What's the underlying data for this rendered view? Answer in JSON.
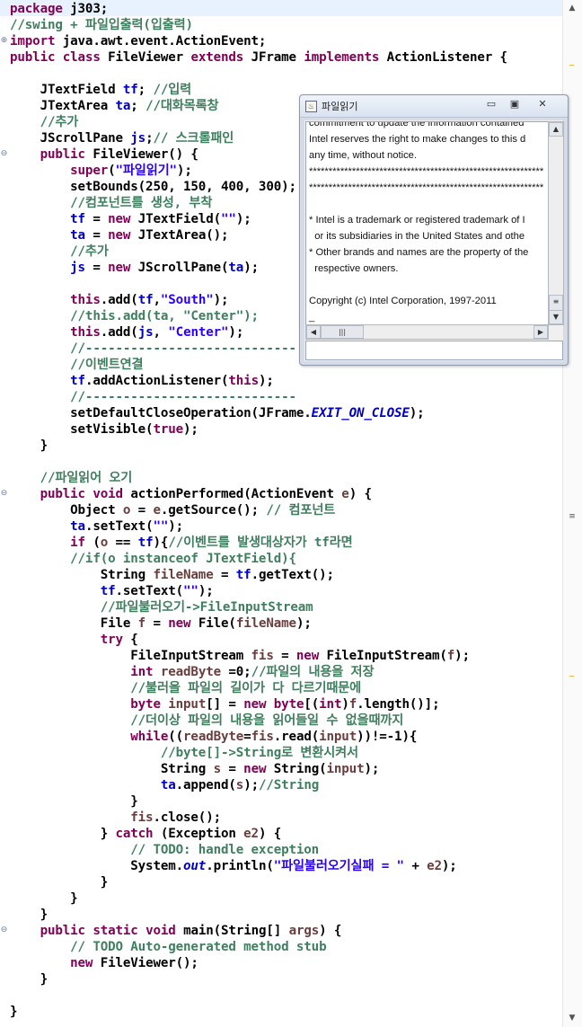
{
  "code_lines": [
    [
      [
        "kw",
        "package"
      ],
      [
        "plain",
        " j303;"
      ]
    ],
    [
      [
        "cm",
        "//swing + 파일입출력(입출력)"
      ]
    ],
    [
      [
        "kw",
        "import"
      ],
      [
        "plain",
        " java.awt.event.ActionEvent;"
      ]
    ],
    [
      [
        "kw",
        "public"
      ],
      [
        "plain",
        " "
      ],
      [
        "kw",
        "class"
      ],
      [
        "plain",
        " FileViewer "
      ],
      [
        "kw",
        "extends"
      ],
      [
        "plain",
        " JFrame "
      ],
      [
        "kw",
        "implements"
      ],
      [
        "plain",
        " ActionListener {"
      ]
    ],
    [],
    [
      [
        "plain",
        "    JTextField "
      ],
      [
        "fld",
        "tf"
      ],
      [
        "plain",
        "; "
      ],
      [
        "cm",
        "//입력"
      ]
    ],
    [
      [
        "plain",
        "    JTextArea "
      ],
      [
        "fld",
        "ta"
      ],
      [
        "plain",
        "; "
      ],
      [
        "cm",
        "//대화목록창"
      ]
    ],
    [
      [
        "plain",
        "    "
      ],
      [
        "cm",
        "//추가"
      ]
    ],
    [
      [
        "plain",
        "    JScrollPane "
      ],
      [
        "fld",
        "js"
      ],
      [
        "plain",
        ";"
      ],
      [
        "cm",
        "// 스크롤패인"
      ]
    ],
    [
      [
        "plain",
        "    "
      ],
      [
        "kw",
        "public"
      ],
      [
        "plain",
        " FileViewer() {"
      ]
    ],
    [
      [
        "plain",
        "        "
      ],
      [
        "kw",
        "super"
      ],
      [
        "plain",
        "("
      ],
      [
        "str",
        "\"파일읽기\""
      ],
      [
        "plain",
        ");"
      ]
    ],
    [
      [
        "plain",
        "        setBounds(250, 150, 400, 300);"
      ]
    ],
    [
      [
        "plain",
        "        "
      ],
      [
        "cm",
        "//컴포넌트를 생성, 부착"
      ]
    ],
    [
      [
        "plain",
        "        "
      ],
      [
        "fld",
        "tf"
      ],
      [
        "plain",
        " = "
      ],
      [
        "kw",
        "new"
      ],
      [
        "plain",
        " JTextField("
      ],
      [
        "str",
        "\"\""
      ],
      [
        "plain",
        ");"
      ]
    ],
    [
      [
        "plain",
        "        "
      ],
      [
        "fld",
        "ta"
      ],
      [
        "plain",
        " = "
      ],
      [
        "kw",
        "new"
      ],
      [
        "plain",
        " JTextArea();"
      ]
    ],
    [
      [
        "plain",
        "        "
      ],
      [
        "cm",
        "//추가"
      ]
    ],
    [
      [
        "plain",
        "        "
      ],
      [
        "fld",
        "js"
      ],
      [
        "plain",
        " = "
      ],
      [
        "kw",
        "new"
      ],
      [
        "plain",
        " JScrollPane("
      ],
      [
        "fld",
        "ta"
      ],
      [
        "plain",
        ");"
      ]
    ],
    [],
    [
      [
        "plain",
        "        "
      ],
      [
        "kw",
        "this"
      ],
      [
        "plain",
        ".add("
      ],
      [
        "fld",
        "tf"
      ],
      [
        "plain",
        ","
      ],
      [
        "str",
        "\"South\""
      ],
      [
        "plain",
        ");"
      ]
    ],
    [
      [
        "plain",
        "        "
      ],
      [
        "cm",
        "//this.add(ta, \"Center\");"
      ]
    ],
    [
      [
        "plain",
        "        "
      ],
      [
        "kw",
        "this"
      ],
      [
        "plain",
        ".add("
      ],
      [
        "fld",
        "js"
      ],
      [
        "plain",
        ", "
      ],
      [
        "str",
        "\"Center\""
      ],
      [
        "plain",
        ");"
      ]
    ],
    [
      [
        "plain",
        "        "
      ],
      [
        "cm",
        "//----------------------------"
      ]
    ],
    [
      [
        "plain",
        "        "
      ],
      [
        "cm",
        "//이벤트연결"
      ]
    ],
    [
      [
        "plain",
        "        "
      ],
      [
        "fld",
        "tf"
      ],
      [
        "plain",
        ".addActionListener("
      ],
      [
        "kw",
        "this"
      ],
      [
        "plain",
        ");"
      ]
    ],
    [
      [
        "plain",
        "        "
      ],
      [
        "cm",
        "//----------------------------"
      ]
    ],
    [
      [
        "plain",
        "        setDefaultCloseOperation(JFrame."
      ],
      [
        "sfld",
        "EXIT_ON_CLOSE"
      ],
      [
        "plain",
        ");"
      ]
    ],
    [
      [
        "plain",
        "        setVisible("
      ],
      [
        "kw",
        "true"
      ],
      [
        "plain",
        ");"
      ]
    ],
    [
      [
        "plain",
        "    }"
      ]
    ],
    [],
    [
      [
        "plain",
        "    "
      ],
      [
        "cm",
        "//파일읽어 오기"
      ]
    ],
    [
      [
        "plain",
        "    "
      ],
      [
        "kw",
        "public"
      ],
      [
        "plain",
        " "
      ],
      [
        "kw",
        "void"
      ],
      [
        "plain",
        " actionPerformed(ActionEvent "
      ],
      [
        "var",
        "e"
      ],
      [
        "plain",
        ") {"
      ]
    ],
    [
      [
        "plain",
        "        Object "
      ],
      [
        "var",
        "o"
      ],
      [
        "plain",
        " = "
      ],
      [
        "var",
        "e"
      ],
      [
        "plain",
        ".getSource(); "
      ],
      [
        "cm",
        "// 컴포넌트"
      ]
    ],
    [
      [
        "plain",
        "        "
      ],
      [
        "fld",
        "ta"
      ],
      [
        "plain",
        ".setText("
      ],
      [
        "str",
        "\"\""
      ],
      [
        "plain",
        ");"
      ]
    ],
    [
      [
        "plain",
        "        "
      ],
      [
        "kw",
        "if"
      ],
      [
        "plain",
        " ("
      ],
      [
        "var",
        "o"
      ],
      [
        "plain",
        " == "
      ],
      [
        "fld",
        "tf"
      ],
      [
        "plain",
        "){"
      ],
      [
        "cm",
        "//이벤트를 발생대상자가 tf라면"
      ]
    ],
    [
      [
        "plain",
        "        "
      ],
      [
        "cm",
        "//if(o instanceof JTextField){"
      ]
    ],
    [
      [
        "plain",
        "            String "
      ],
      [
        "var",
        "fileName"
      ],
      [
        "plain",
        " = "
      ],
      [
        "fld",
        "tf"
      ],
      [
        "plain",
        ".getText();"
      ]
    ],
    [
      [
        "plain",
        "            "
      ],
      [
        "fld",
        "tf"
      ],
      [
        "plain",
        ".setText("
      ],
      [
        "str",
        "\"\""
      ],
      [
        "plain",
        ");"
      ]
    ],
    [
      [
        "plain",
        "            "
      ],
      [
        "cm",
        "//파일불러오기->FileInputStream"
      ]
    ],
    [
      [
        "plain",
        "            File "
      ],
      [
        "var",
        "f"
      ],
      [
        "plain",
        " = "
      ],
      [
        "kw",
        "new"
      ],
      [
        "plain",
        " File("
      ],
      [
        "var",
        "fileName"
      ],
      [
        "plain",
        ");"
      ]
    ],
    [
      [
        "plain",
        "            "
      ],
      [
        "kw",
        "try"
      ],
      [
        "plain",
        " {"
      ]
    ],
    [
      [
        "plain",
        "                FileInputStream "
      ],
      [
        "var",
        "fis"
      ],
      [
        "plain",
        " = "
      ],
      [
        "kw",
        "new"
      ],
      [
        "plain",
        " FileInputStream("
      ],
      [
        "var",
        "f"
      ],
      [
        "plain",
        ");"
      ]
    ],
    [
      [
        "plain",
        "                "
      ],
      [
        "kw",
        "int"
      ],
      [
        "plain",
        " "
      ],
      [
        "var",
        "readByte"
      ],
      [
        "plain",
        " =0;"
      ],
      [
        "cm",
        "//파일의 내용을 저장"
      ]
    ],
    [
      [
        "plain",
        "                "
      ],
      [
        "cm",
        "//불러올 파일의 길이가 다 다르기때문에"
      ]
    ],
    [
      [
        "plain",
        "                "
      ],
      [
        "kw",
        "byte"
      ],
      [
        "plain",
        " "
      ],
      [
        "var",
        "input"
      ],
      [
        "plain",
        "[] = "
      ],
      [
        "kw",
        "new"
      ],
      [
        "plain",
        " "
      ],
      [
        "kw",
        "byte"
      ],
      [
        "plain",
        "[("
      ],
      [
        "kw",
        "int"
      ],
      [
        "plain",
        ")"
      ],
      [
        "var",
        "f"
      ],
      [
        "plain",
        ".length()];"
      ]
    ],
    [
      [
        "plain",
        "                "
      ],
      [
        "cm",
        "//더이상 파일의 내용을 읽어들일 수 없을때까지"
      ]
    ],
    [
      [
        "plain",
        "                "
      ],
      [
        "kw",
        "while"
      ],
      [
        "plain",
        "(("
      ],
      [
        "var",
        "readByte"
      ],
      [
        "plain",
        "="
      ],
      [
        "var",
        "fis"
      ],
      [
        "plain",
        ".read("
      ],
      [
        "var",
        "input"
      ],
      [
        "plain",
        "))!=-1){"
      ]
    ],
    [
      [
        "plain",
        "                    "
      ],
      [
        "cm",
        "//byte[]->String로 변환시켜서"
      ]
    ],
    [
      [
        "plain",
        "                    String "
      ],
      [
        "var",
        "s"
      ],
      [
        "plain",
        " = "
      ],
      [
        "kw",
        "new"
      ],
      [
        "plain",
        " String("
      ],
      [
        "var",
        "input"
      ],
      [
        "plain",
        ");"
      ]
    ],
    [
      [
        "plain",
        "                    "
      ],
      [
        "fld",
        "ta"
      ],
      [
        "plain",
        ".append("
      ],
      [
        "var",
        "s"
      ],
      [
        "plain",
        ");"
      ],
      [
        "cm",
        "//String"
      ]
    ],
    [
      [
        "plain",
        "                }"
      ]
    ],
    [
      [
        "plain",
        "                "
      ],
      [
        "var",
        "fis"
      ],
      [
        "plain",
        ".close();"
      ]
    ],
    [
      [
        "plain",
        "            } "
      ],
      [
        "kw",
        "catch"
      ],
      [
        "plain",
        " (Exception "
      ],
      [
        "var",
        "e2"
      ],
      [
        "plain",
        ") {"
      ]
    ],
    [
      [
        "plain",
        "                "
      ],
      [
        "cm",
        "// TODO: handle exception"
      ]
    ],
    [
      [
        "plain",
        "                System."
      ],
      [
        "sfld",
        "out"
      ],
      [
        "plain",
        ".println("
      ],
      [
        "str",
        "\"파일불러오기실패 = \""
      ],
      [
        "plain",
        " + "
      ],
      [
        "var",
        "e2"
      ],
      [
        "plain",
        ");"
      ]
    ],
    [
      [
        "plain",
        "            }"
      ]
    ],
    [
      [
        "plain",
        "        }"
      ]
    ],
    [
      [
        "plain",
        "    }"
      ]
    ],
    [
      [
        "plain",
        "    "
      ],
      [
        "kw",
        "public"
      ],
      [
        "plain",
        " "
      ],
      [
        "kw",
        "static"
      ],
      [
        "plain",
        " "
      ],
      [
        "kw",
        "void"
      ],
      [
        "plain",
        " main(String[] "
      ],
      [
        "var",
        "args"
      ],
      [
        "plain",
        ") {"
      ]
    ],
    [
      [
        "plain",
        "        "
      ],
      [
        "cm",
        "// TODO Auto-generated method stub"
      ]
    ],
    [
      [
        "plain",
        "        "
      ],
      [
        "kw",
        "new"
      ],
      [
        "plain",
        " FileViewer();"
      ]
    ],
    [
      [
        "plain",
        "    }"
      ]
    ],
    [],
    [
      [
        "plain",
        "}"
      ]
    ]
  ],
  "fold_markers": {
    "import_line": "⊕",
    "method_lines": "⊖"
  },
  "editor_scrollbar": {
    "up_icon": "▲",
    "down_icon": "▼",
    "thumb_icon": "≡"
  },
  "window": {
    "title": "파일읽기",
    "app_icon": "♨",
    "minimize_icon": "▭",
    "maximize_icon": "▣",
    "close_icon": "✕",
    "text_lines": [
      "commitment to update the information contained",
      "Intel reserves the right to make changes to this d",
      "any time, without notice.",
      "************************************************************",
      "************************************************************",
      "",
      "* Intel is a trademark or registered trademark of I",
      "  or its subsidiaries in the United States and othe",
      "* Other brands and names are the property of the",
      "  respective owners.",
      "",
      "Copyright (c) Intel Corporation, 1997-2011",
      "_"
    ],
    "text_field_value": "",
    "scroll_up": "▲",
    "scroll_down": "▼",
    "scroll_left": "◀",
    "scroll_right": "▶",
    "scroll_grip": "≡",
    "hscroll_grip": "|||"
  }
}
